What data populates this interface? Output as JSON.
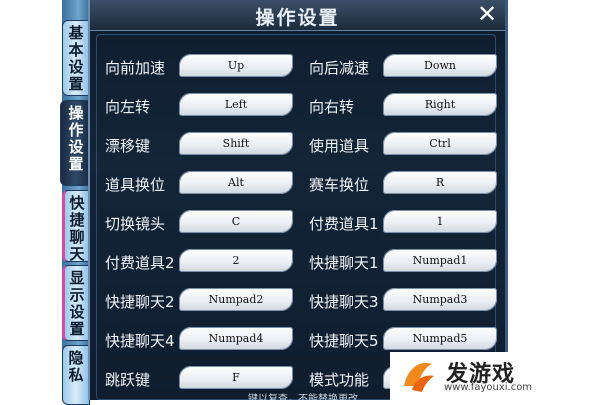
{
  "window": {
    "title": "操作设置",
    "close_glyph": "✕"
  },
  "side_tabs": [
    {
      "label": "基本设置"
    },
    {
      "label": "操作设置",
      "active": true
    },
    {
      "label": "快捷聊天"
    },
    {
      "label": "显示设置"
    },
    {
      "label": "隐私"
    }
  ],
  "settings": [
    [
      {
        "label": "向前加速",
        "key": "Up"
      },
      {
        "label": "向后减速",
        "key": "Down"
      }
    ],
    [
      {
        "label": "向左转",
        "key": "Left"
      },
      {
        "label": "向右转",
        "key": "Right"
      }
    ],
    [
      {
        "label": "漂移键",
        "key": "Shift"
      },
      {
        "label": "使用道具",
        "key": "Ctrl"
      }
    ],
    [
      {
        "label": "道具换位",
        "key": "Alt"
      },
      {
        "label": "赛车换位",
        "key": "R"
      }
    ],
    [
      {
        "label": "切换镜头",
        "key": "C"
      },
      {
        "label": "付费道具1",
        "key": "1"
      }
    ],
    [
      {
        "label": "付费道具2",
        "key": "2"
      },
      {
        "label": "快捷聊天1",
        "key": "Numpad1"
      }
    ],
    [
      {
        "label": "快捷聊天2",
        "key": "Numpad2"
      },
      {
        "label": "快捷聊天3",
        "key": "Numpad3"
      }
    ],
    [
      {
        "label": "快捷聊天4",
        "key": "Numpad4"
      },
      {
        "label": "快捷聊天5",
        "key": "Numpad5"
      }
    ],
    [
      {
        "label": "跳跃键",
        "key": "F"
      },
      {
        "label": "模式功能",
        "key": ""
      }
    ]
  ],
  "bottom_note": "…键以复查，不能替换更改",
  "watermark": {
    "name": "发游戏",
    "url": "www.fayouxi.com"
  },
  "colors": {
    "panel": "#142538",
    "accent": "#6b8fb5",
    "key_bg": "#e9edf2",
    "watermark_orange": "#f08a1c"
  }
}
